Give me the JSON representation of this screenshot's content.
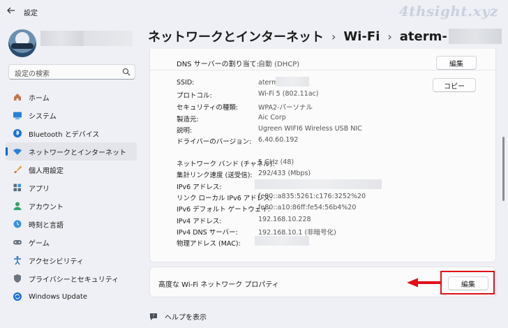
{
  "app": {
    "title": "設定",
    "watermark": "4thsight.xyz"
  },
  "search": {
    "placeholder": "設定の検索"
  },
  "sidebar": {
    "items": [
      {
        "label": "ホーム",
        "icon": "home-icon"
      },
      {
        "label": "システム",
        "icon": "system-icon"
      },
      {
        "label": "Bluetooth とデバイス",
        "icon": "bluetooth-icon"
      },
      {
        "label": "ネットワークとインターネット",
        "icon": "wifi-icon",
        "active": true
      },
      {
        "label": "個人用設定",
        "icon": "brush-icon"
      },
      {
        "label": "アプリ",
        "icon": "apps-icon"
      },
      {
        "label": "アカウント",
        "icon": "account-icon"
      },
      {
        "label": "時刻と言語",
        "icon": "globe-clock-icon"
      },
      {
        "label": "ゲーム",
        "icon": "gamepad-icon"
      },
      {
        "label": "アクセシビリティ",
        "icon": "accessibility-icon"
      },
      {
        "label": "プライバシーとセキュリティ",
        "icon": "shield-icon"
      },
      {
        "label": "Windows Update",
        "icon": "update-icon"
      }
    ]
  },
  "breadcrumb": {
    "root": "ネットワークとインターネット",
    "sep": "›",
    "middle": "Wi-Fi",
    "current": "aterm-"
  },
  "dns": {
    "label": "DNS サーバーの割り当て:",
    "value": "自動 (DHCP)",
    "edit_label": "編集"
  },
  "copy_label": "コピー",
  "properties": {
    "group1": [
      {
        "label": "SSID:",
        "value": "aterm"
      },
      {
        "label": "プロトコル:",
        "value": "Wi-Fi 5 (802.11ac)"
      },
      {
        "label": "セキュリティの種類:",
        "value": "WPA2-パーソナル"
      },
      {
        "label": "製造元:",
        "value": "Aic Corp"
      },
      {
        "label": "説明:",
        "value": "Ugreen WIFI6 Wireless USB NIC"
      },
      {
        "label": "ドライバーのバージョン:",
        "value": "6.40.60.192"
      }
    ],
    "group2": [
      {
        "label": "ネットワーク バンド (チャネル):",
        "value": "5 GHz (48)"
      },
      {
        "label": "集計リンク速度 (送受信):",
        "value": "292/433 (Mbps)"
      },
      {
        "label": "IPv6 アドレス:",
        "value": ""
      },
      {
        "label": "リンク ローカル IPv6 アドレス:",
        "value": "fe80::a835:5261:c176:3252%20"
      },
      {
        "label": "IPv6 デフォルト ゲートウェイ:",
        "value": "fe80::a10:86ff:fe54:56b4%20"
      },
      {
        "label": "IPv4 アドレス:",
        "value": "192.168.10.228"
      },
      {
        "label": "IPv4 DNS サーバー:",
        "value": "192.168.10.1 (非暗号化)"
      },
      {
        "label": "物理アドレス (MAC):",
        "value": ""
      }
    ]
  },
  "advanced": {
    "label": "高度な Wi-Fi ネットワーク プロパティ",
    "edit_label": "編集"
  },
  "help": {
    "label": "ヘルプを表示"
  },
  "colors": {
    "accent": "#0067c0",
    "highlight": "#e0101a"
  }
}
